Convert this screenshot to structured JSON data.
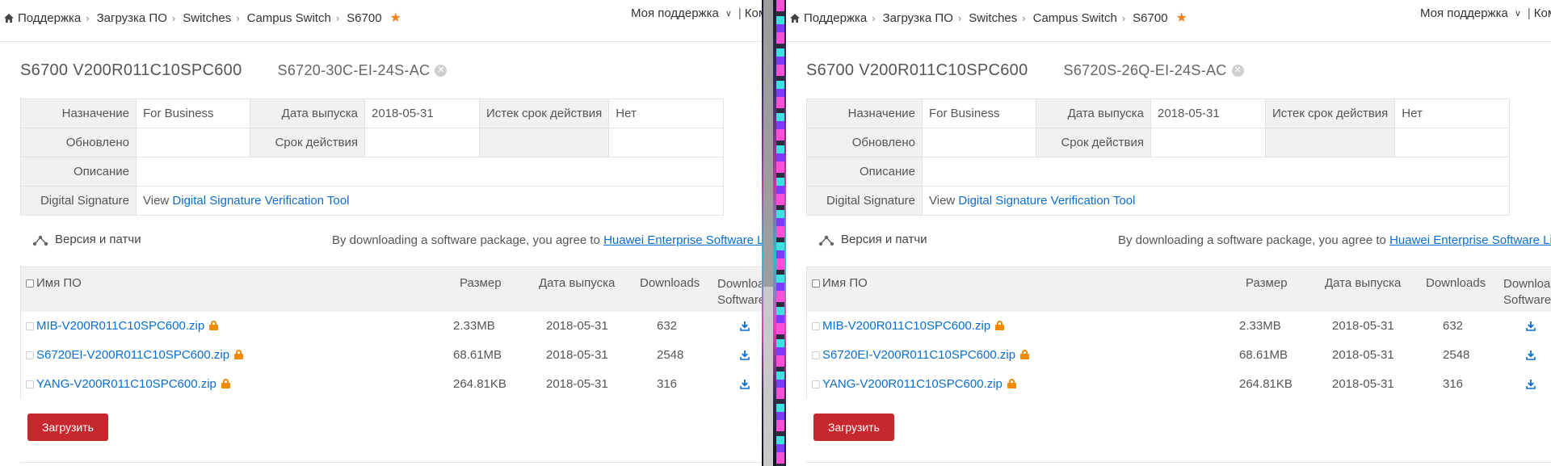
{
  "panes": [
    {
      "breadcrumb": [
        "Поддержка",
        "Загрузка ПО",
        "Switches",
        "Campus Switch",
        "S6700"
      ],
      "support_menu": "Моя поддержка",
      "support_extra": "Коммент",
      "version_title": "S6700 V200R011C10SPC600",
      "model": "S6720-30C-EI-24S-AC",
      "info": {
        "purpose_label": "Назначение",
        "purpose": "For Business",
        "release_label": "Дата выпуска",
        "release": "2018-05-31",
        "expired_label": "Истек срок действия",
        "expired": "Нет",
        "updated_label": "Обновлено",
        "updated": "",
        "validity_label": "Срок действия",
        "validity": "",
        "desc_label": "Описание",
        "desc": "",
        "sig_label": "Digital Signature",
        "sig_prefix": "View",
        "sig_link": "Digital Signature Verification Tool"
      },
      "versions_label": "Версия и патчи",
      "agree_text": "By downloading a software package, you agree to",
      "agree_link": "Huawei Enterprise Software License",
      "table": {
        "headers": {
          "name": "Имя ПО",
          "size": "Размер",
          "date": "Дата выпуска",
          "downloads": "Downloads",
          "download_sw_1": "Download",
          "download_sw_2": "Software"
        },
        "rows": [
          {
            "name": "MIB-V200R011C10SPC600.zip",
            "size": "2.33MB",
            "date": "2018-05-31",
            "downloads": "632"
          },
          {
            "name": "S6720EI-V200R011C10SPC600.zip",
            "size": "68.61MB",
            "date": "2018-05-31",
            "downloads": "2548"
          },
          {
            "name": "YANG-V200R011C10SPC600.zip",
            "size": "264.81KB",
            "date": "2018-05-31",
            "downloads": "316"
          }
        ]
      },
      "load_button": "Загрузить"
    },
    {
      "breadcrumb": [
        "Поддержка",
        "Загрузка ПО",
        "Switches",
        "Campus Switch",
        "S6700"
      ],
      "support_menu": "Моя поддержка",
      "support_extra": "Коммент",
      "version_title": "S6700 V200R011C10SPC600",
      "model": "S6720S-26Q-EI-24S-AC",
      "info": {
        "purpose_label": "Назначение",
        "purpose": "For Business",
        "release_label": "Дата выпуска",
        "release": "2018-05-31",
        "expired_label": "Истек срок действия",
        "expired": "Нет",
        "updated_label": "Обновлено",
        "updated": "",
        "validity_label": "Срок действия",
        "validity": "",
        "desc_label": "Описание",
        "desc": "",
        "sig_label": "Digital Signature",
        "sig_prefix": "View",
        "sig_link": "Digital Signature Verification Tool"
      },
      "versions_label": "Версия и патчи",
      "agree_text": "By downloading a software package, you agree to",
      "agree_link": "Huawei Enterprise Software License",
      "table": {
        "headers": {
          "name": "Имя ПО",
          "size": "Размер",
          "date": "Дата выпуска",
          "downloads": "Downloads",
          "download_sw_1": "Download",
          "download_sw_2": "Software"
        },
        "rows": [
          {
            "name": "MIB-V200R011C10SPC600.zip",
            "size": "2.33MB",
            "date": "2018-05-31",
            "downloads": "632"
          },
          {
            "name": "S6720EI-V200R011C10SPC600.zip",
            "size": "68.61MB",
            "date": "2018-05-31",
            "downloads": "2548"
          },
          {
            "name": "YANG-V200R011C10SPC600.zip",
            "size": "264.81KB",
            "date": "2018-05-31",
            "downloads": "316"
          }
        ]
      },
      "load_button": "Загрузить"
    }
  ],
  "colors": {
    "link": "#0a6ed1",
    "accent_red": "#c7282e",
    "star": "#f0801e",
    "lock": "#f08a00"
  }
}
